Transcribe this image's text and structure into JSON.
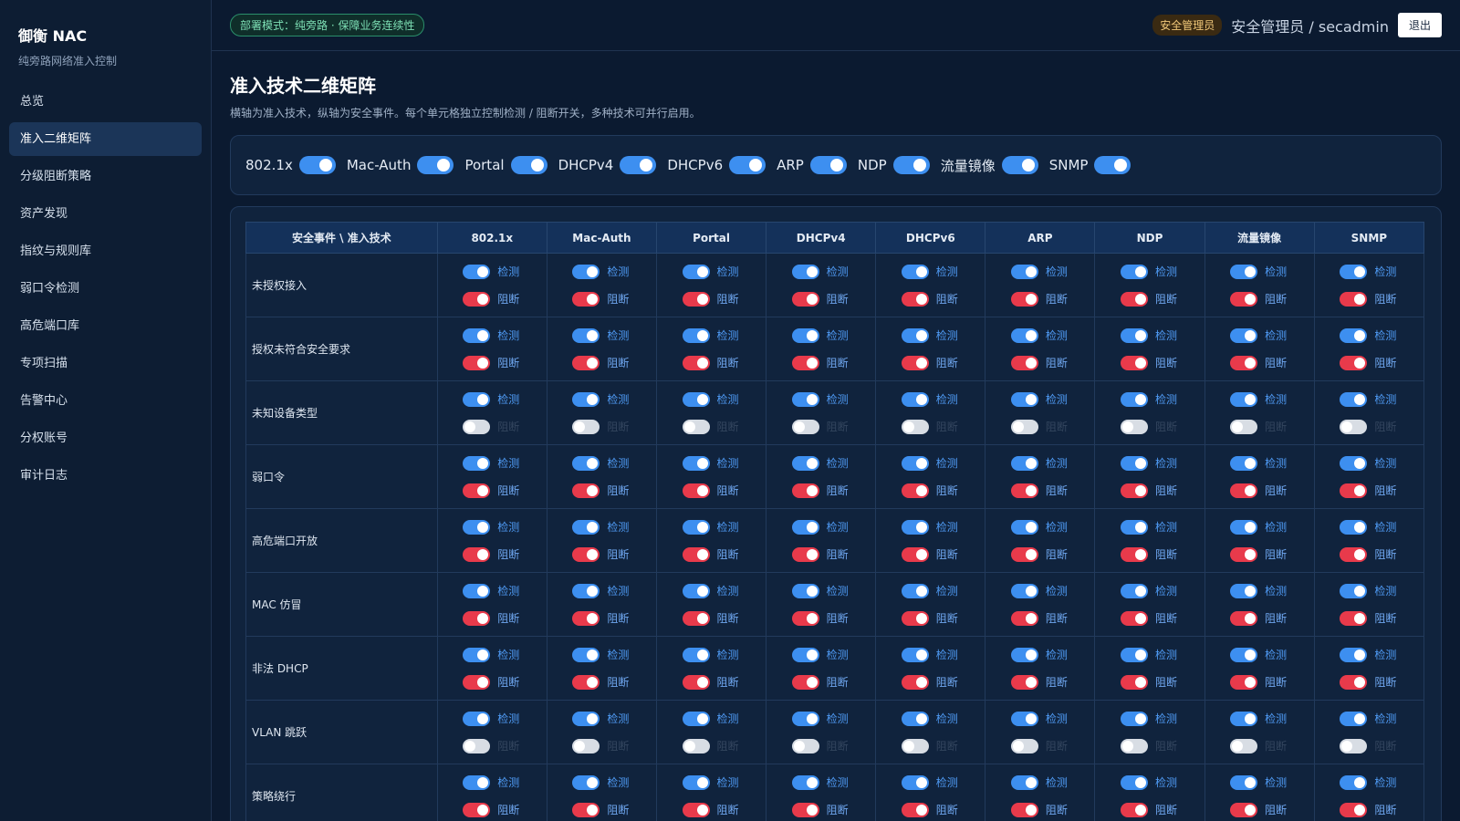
{
  "sidebar": {
    "brand_title": "御衡 NAC",
    "brand_subtitle": "纯旁路网络准入控制",
    "items": [
      {
        "label": "总览",
        "active": false
      },
      {
        "label": "准入二维矩阵",
        "active": true
      },
      {
        "label": "分级阻断策略",
        "active": false
      },
      {
        "label": "资产发现",
        "active": false
      },
      {
        "label": "指纹与规则库",
        "active": false
      },
      {
        "label": "弱口令检测",
        "active": false
      },
      {
        "label": "高危端口库",
        "active": false
      },
      {
        "label": "专项扫描",
        "active": false
      },
      {
        "label": "告警中心",
        "active": false
      },
      {
        "label": "分权账号",
        "active": false
      },
      {
        "label": "审计日志",
        "active": false
      }
    ]
  },
  "header": {
    "mode_badge": "部署模式：纯旁路 · 保障业务连续性",
    "role_badge": "安全管理员",
    "user_text": "安全管理员 / secadmin",
    "logout_label": "退出"
  },
  "page": {
    "title": "准入技术二维矩阵",
    "description": "横轴为准入技术，纵轴为安全事件。每个单元格独立控制检测 / 阻断开关，多种技术可并行启用。"
  },
  "technologies": [
    {
      "label": "802.1x",
      "enabled": true
    },
    {
      "label": "Mac-Auth",
      "enabled": true
    },
    {
      "label": "Portal",
      "enabled": true
    },
    {
      "label": "DHCPv4",
      "enabled": true
    },
    {
      "label": "DHCPv6",
      "enabled": true
    },
    {
      "label": "ARP",
      "enabled": true
    },
    {
      "label": "NDP",
      "enabled": true
    },
    {
      "label": "流量镜像",
      "enabled": true
    },
    {
      "label": "SNMP",
      "enabled": true
    }
  ],
  "matrix": {
    "corner_header": "安全事件 \\ 准入技术",
    "detect_label": "检测",
    "block_label": "阻断",
    "events": [
      {
        "name": "未授权接入",
        "detect": true,
        "block": true
      },
      {
        "name": "授权未符合安全要求",
        "detect": true,
        "block": true
      },
      {
        "name": "未知设备类型",
        "detect": true,
        "block": false
      },
      {
        "name": "弱口令",
        "detect": true,
        "block": true
      },
      {
        "name": "高危端口开放",
        "detect": true,
        "block": true
      },
      {
        "name": "MAC 仿冒",
        "detect": true,
        "block": true
      },
      {
        "name": "非法 DHCP",
        "detect": true,
        "block": true
      },
      {
        "name": "VLAN 跳跃",
        "detect": true,
        "block": false
      },
      {
        "name": "策略绕行",
        "detect": true,
        "block": true
      }
    ]
  },
  "colors": {
    "detect_on": "#3d8ff0",
    "block_on": "#e83a4b",
    "toggle_off": "#d8dde4"
  }
}
